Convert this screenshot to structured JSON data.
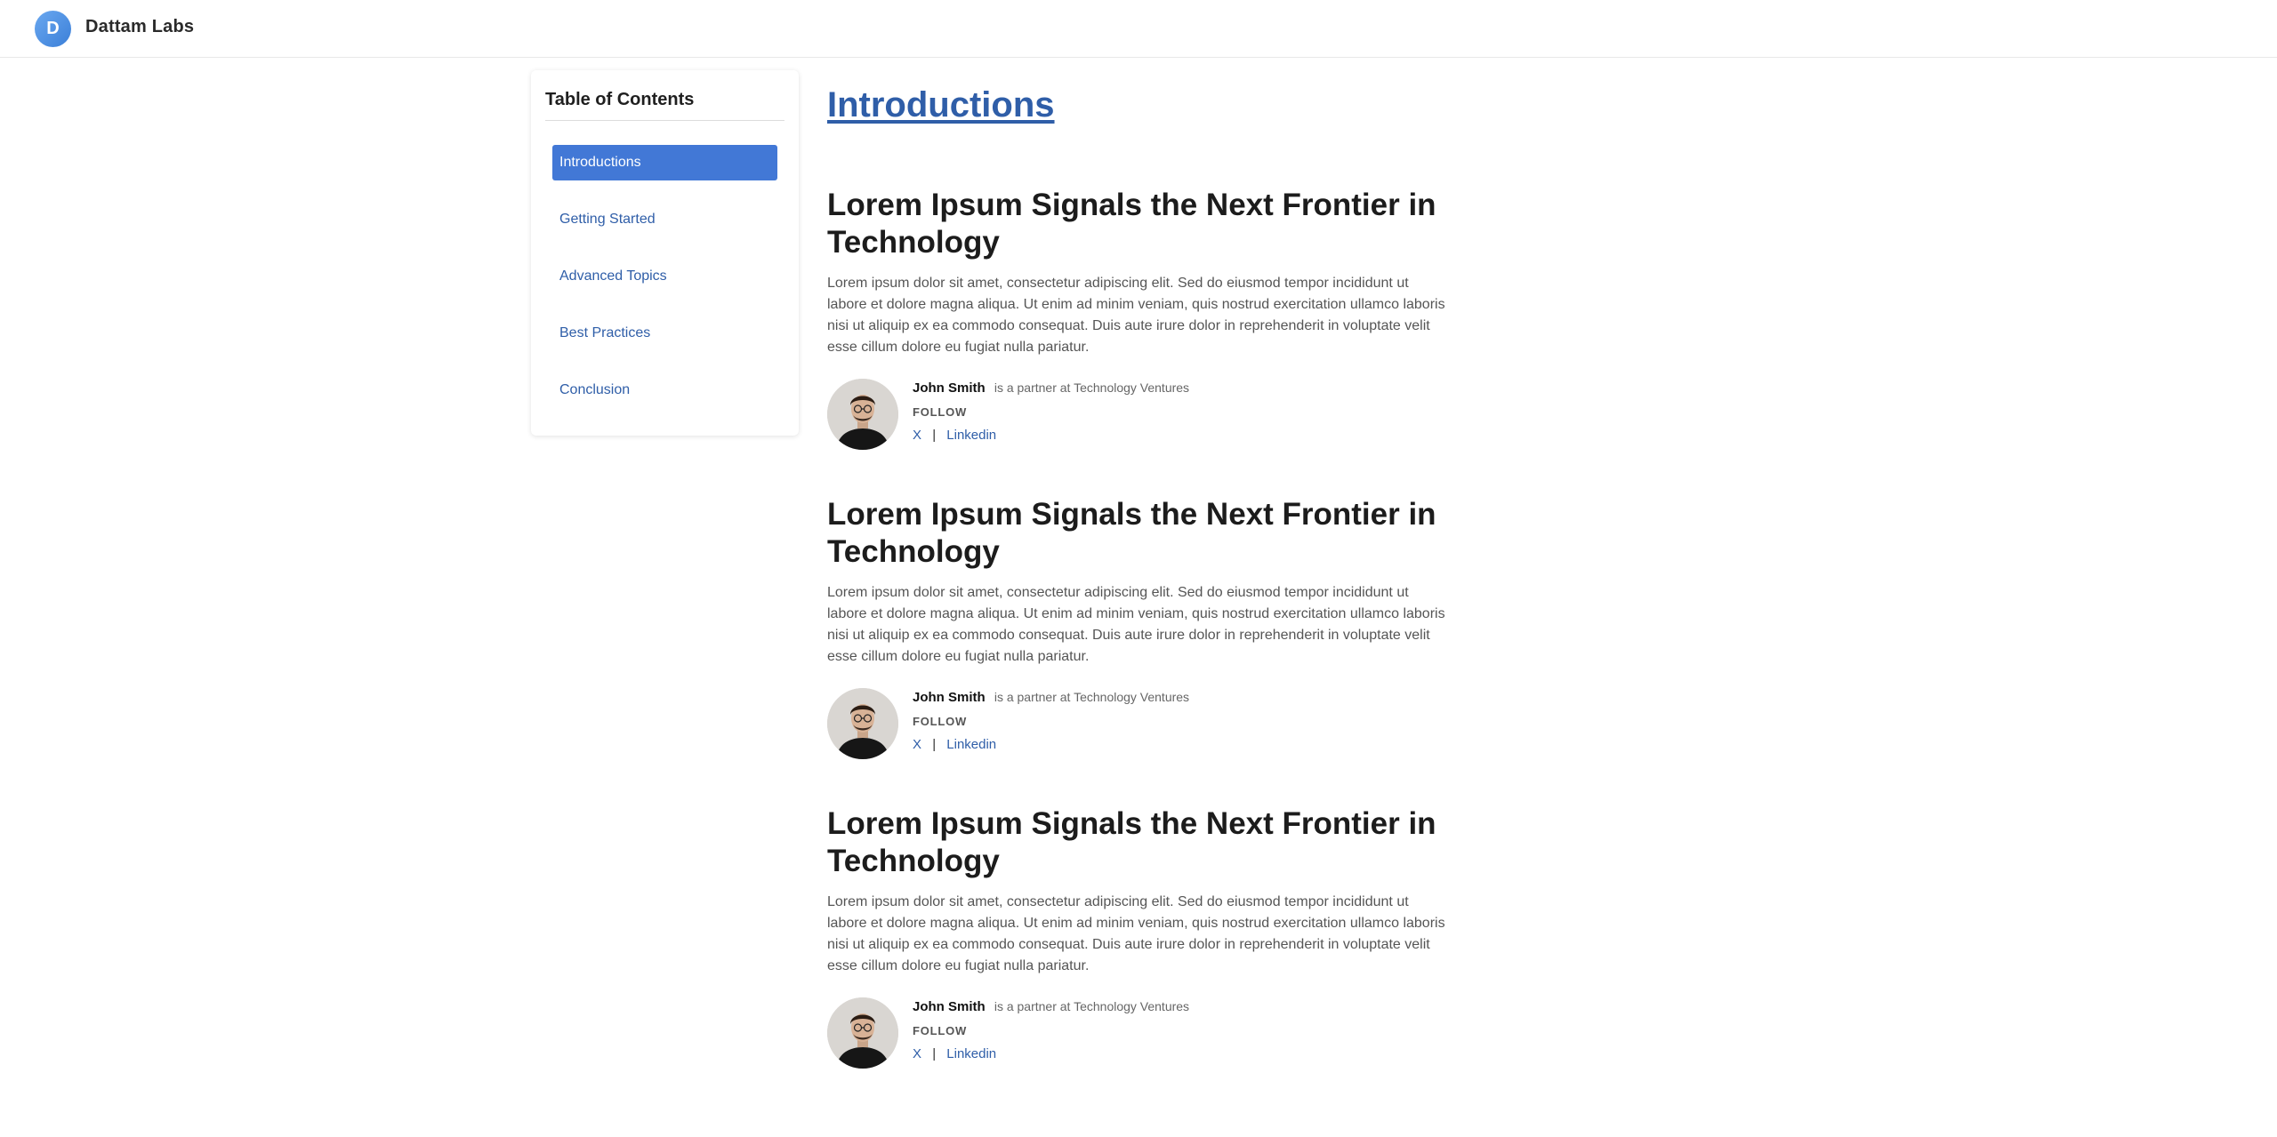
{
  "header": {
    "logo_letter": "D",
    "brand": "Dattam Labs"
  },
  "toc": {
    "title": "Table of Contents",
    "items": [
      {
        "label": "Introductions",
        "active": true
      },
      {
        "label": "Getting Started",
        "active": false
      },
      {
        "label": "Advanced Topics",
        "active": false
      },
      {
        "label": "Best Practices",
        "active": false
      },
      {
        "label": "Conclusion",
        "active": false
      }
    ]
  },
  "main": {
    "section_title": "Introductions",
    "articles": [
      {
        "title": "Lorem Ipsum Signals the Next Frontier in Technology",
        "body": "Lorem ipsum dolor sit amet, consectetur adipiscing elit. Sed do eiusmod tempor incididunt ut labore et dolore magna aliqua. Ut enim ad minim veniam, quis nostrud exercitation ullamco laboris nisi ut aliquip ex ea commodo consequat. Duis aute irure dolor in reprehenderit in voluptate velit esse cillum dolore eu fugiat nulla pariatur.",
        "author_name": "John Smith",
        "author_role": "is a partner at Technology Ventures",
        "follow_label": "FOLLOW",
        "social_x": "X",
        "social_sep": "|",
        "social_linkedin": "Linkedin"
      },
      {
        "title": "Lorem Ipsum Signals the Next Frontier in Technology",
        "body": "Lorem ipsum dolor sit amet, consectetur adipiscing elit. Sed do eiusmod tempor incididunt ut labore et dolore magna aliqua. Ut enim ad minim veniam, quis nostrud exercitation ullamco laboris nisi ut aliquip ex ea commodo consequat. Duis aute irure dolor in reprehenderit in voluptate velit esse cillum dolore eu fugiat nulla pariatur.",
        "author_name": "John Smith",
        "author_role": "is a partner at Technology Ventures",
        "follow_label": "FOLLOW",
        "social_x": "X",
        "social_sep": "|",
        "social_linkedin": "Linkedin"
      },
      {
        "title": "Lorem Ipsum Signals the Next Frontier in Technology",
        "body": "Lorem ipsum dolor sit amet, consectetur adipiscing elit. Sed do eiusmod tempor incididunt ut labore et dolore magna aliqua. Ut enim ad minim veniam, quis nostrud exercitation ullamco laboris nisi ut aliquip ex ea commodo consequat. Duis aute irure dolor in reprehenderit in voluptate velit esse cillum dolore eu fugiat nulla pariatur.",
        "author_name": "John Smith",
        "author_role": "is a partner at Technology Ventures",
        "follow_label": "FOLLOW",
        "social_x": "X",
        "social_sep": "|",
        "social_linkedin": "Linkedin"
      }
    ]
  },
  "colors": {
    "accent": "#4278d6",
    "link": "#2f5ea8"
  }
}
